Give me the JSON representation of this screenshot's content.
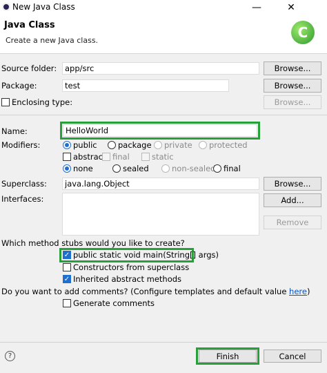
{
  "window": {
    "title": "New Java Class",
    "minimize_icon": "minimize-icon",
    "close_icon": "close-icon"
  },
  "header": {
    "title": "Java Class",
    "description": "Create a new Java class.",
    "icon": "java-class-wizard-icon"
  },
  "form": {
    "source_folder": {
      "label": "Source folder:",
      "value": "app/src",
      "button": "Browse..."
    },
    "package": {
      "label": "Package:",
      "value": "test",
      "button": "Browse..."
    },
    "enclosing_type": {
      "label": "Enclosing type:",
      "checked": false,
      "value": "",
      "button": "Browse..."
    },
    "name": {
      "label": "Name:",
      "value": "HelloWorld"
    },
    "modifiers": {
      "label": "Modifiers:",
      "access": [
        "public",
        "package",
        "private",
        "protected"
      ],
      "selected_access": "public",
      "checks": [
        "abstract",
        "final",
        "static"
      ],
      "sealing": [
        "none",
        "sealed",
        "non-sealed",
        "final"
      ],
      "selected_sealing": "none"
    },
    "superclass": {
      "label": "Superclass:",
      "value": "java.lang.Object",
      "button": "Browse..."
    },
    "interfaces": {
      "label": "Interfaces:",
      "add_button": "Add...",
      "remove_button": "Remove"
    },
    "stubs": {
      "question": "Which method stubs would you like to create?",
      "items": [
        {
          "label": "public static void main(String[] args)",
          "checked": true
        },
        {
          "label": "Constructors from superclass",
          "checked": false
        },
        {
          "label": "Inherited abstract methods",
          "checked": true
        }
      ]
    },
    "comments": {
      "question": "Do you want to add comments? (Configure templates and default value ",
      "link": "here",
      "question_end": ")",
      "generate": {
        "label": "Generate comments",
        "checked": false
      }
    }
  },
  "footer": {
    "help_icon": "help-icon",
    "finish": "Finish",
    "cancel": "Cancel"
  },
  "colors": {
    "highlight": "#27a03a",
    "accent": "#1f6fd1"
  }
}
